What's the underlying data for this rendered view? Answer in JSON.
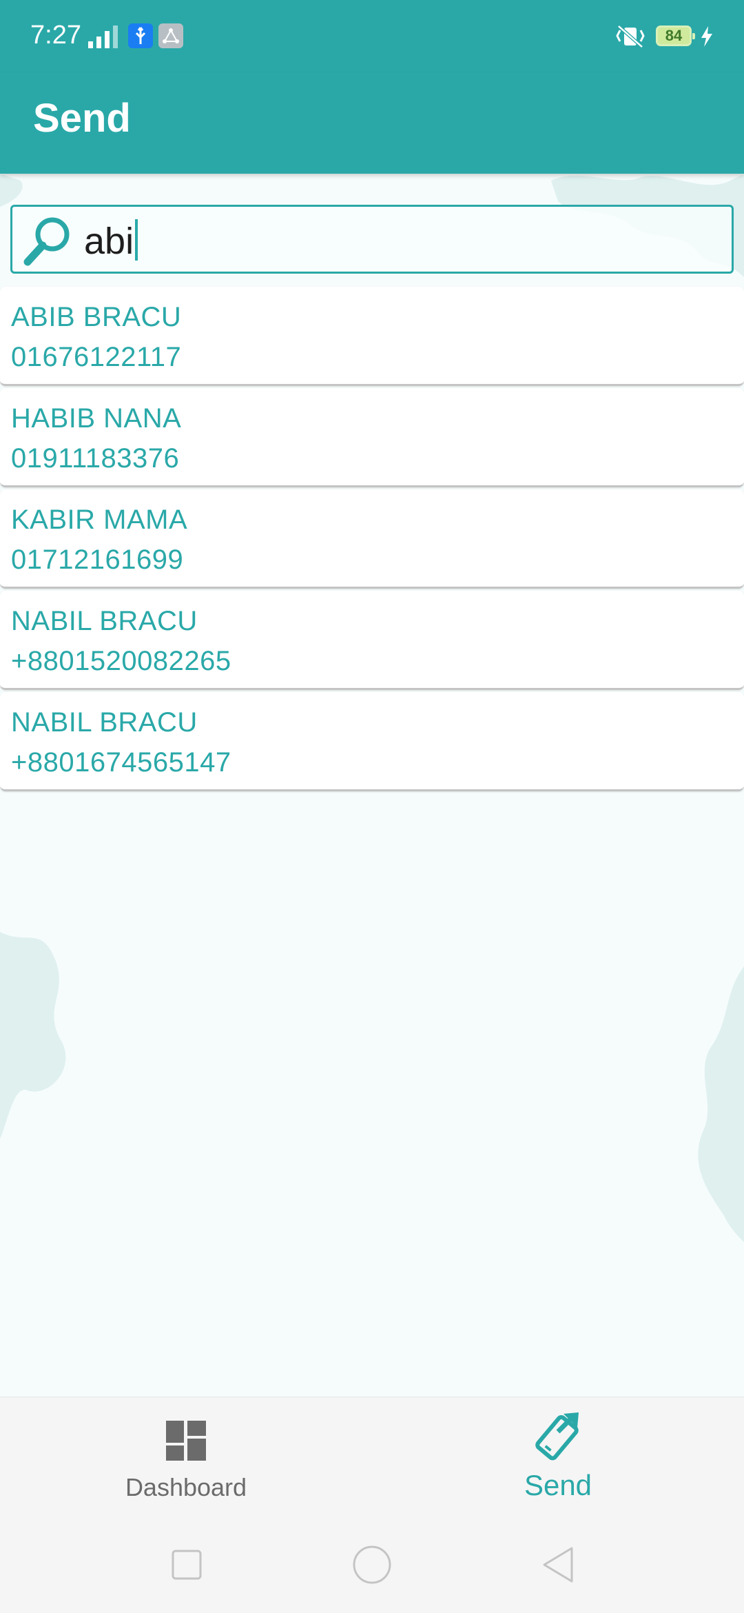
{
  "status_bar": {
    "time": "7:27",
    "battery_level": "84",
    "icons": [
      "signal-icon",
      "usb-icon",
      "notification-icon",
      "vibrate-icon",
      "battery-icon",
      "charging-icon"
    ]
  },
  "app_bar": {
    "title": "Send"
  },
  "search": {
    "value": "abi",
    "icon": "search-icon"
  },
  "contacts": [
    {
      "name": "ABIB BRACU",
      "phone": "01676122117"
    },
    {
      "name": "HABIB NANA",
      "phone": "01911183376"
    },
    {
      "name": "KABIR MAMA",
      "phone": "01712161699"
    },
    {
      "name": "NABIL BRACU",
      "phone": "+8801520082265"
    },
    {
      "name": "NABIL BRACU",
      "phone": "+8801674565147"
    }
  ],
  "bottom_nav": {
    "items": [
      {
        "label": "Dashboard",
        "icon": "dashboard-icon",
        "active": false
      },
      {
        "label": "Send",
        "icon": "send-icon",
        "active": true
      }
    ]
  },
  "system_nav": {
    "buttons": [
      "recents-icon",
      "home-icon",
      "back-icon"
    ]
  },
  "colors": {
    "primary": "#2aa8a8",
    "background": "#f6fcfc",
    "inactive": "#6b6b6b"
  }
}
